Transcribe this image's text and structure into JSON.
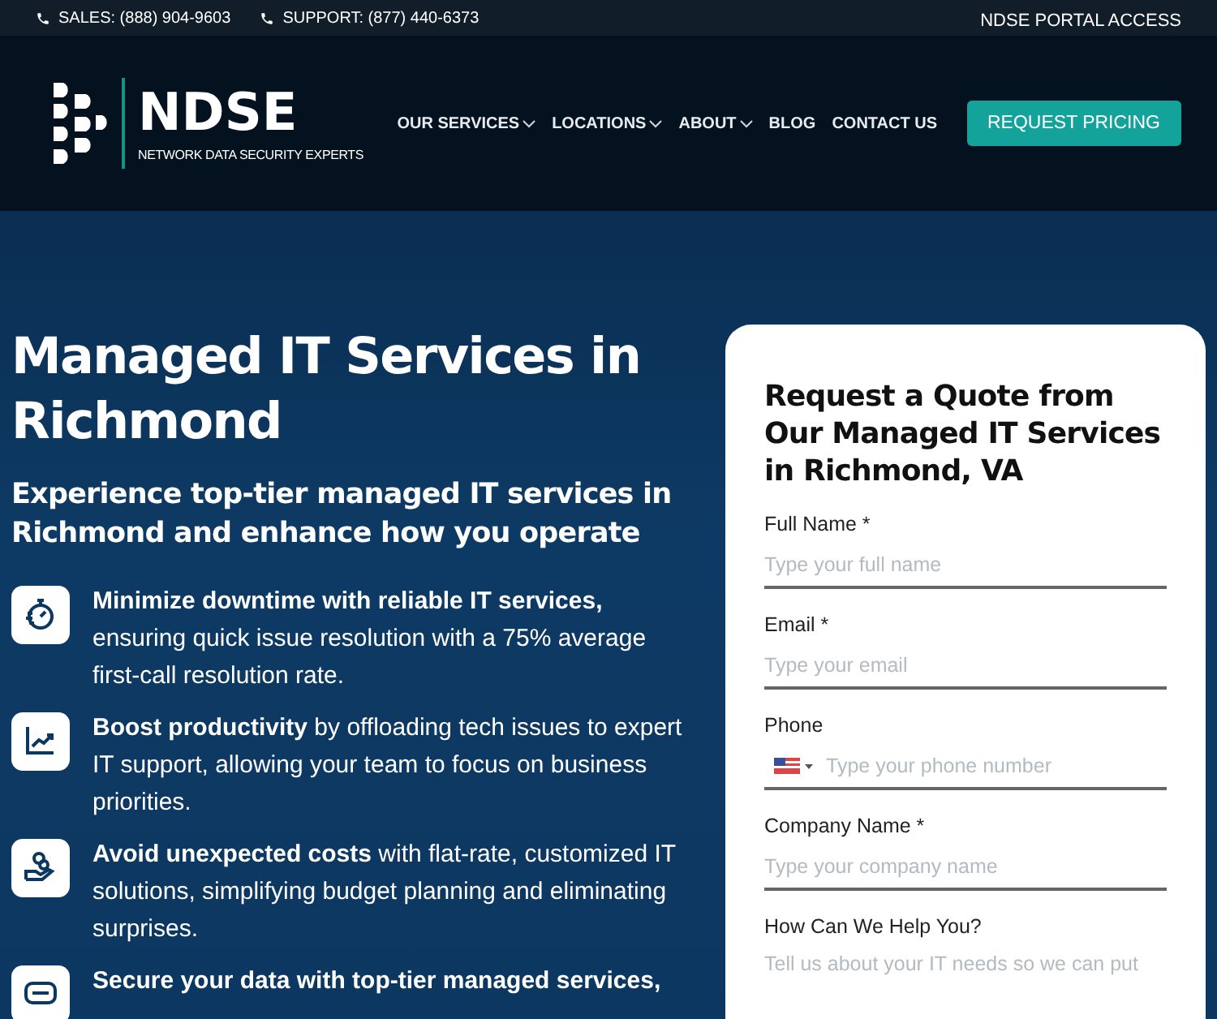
{
  "top_bar": {
    "contacts": [
      {
        "label": "SALES: (888) 904-9603"
      },
      {
        "label": "SUPPORT: (877) 440-6373"
      }
    ],
    "portal_link": "NDSE PORTAL ACCESS"
  },
  "header": {
    "logo": {
      "name": "NDSE",
      "tagline": "NETWORK DATA SECURITY EXPERTS"
    },
    "nav": [
      {
        "label": "OUR SERVICES",
        "has_dropdown": true
      },
      {
        "label": "LOCATIONS",
        "has_dropdown": true
      },
      {
        "label": "ABOUT",
        "has_dropdown": true
      },
      {
        "label": "BLOG",
        "has_dropdown": false
      },
      {
        "label": "CONTACT US",
        "has_dropdown": false
      }
    ],
    "cta": "REQUEST PRICING"
  },
  "hero": {
    "title": "Managed IT Services in Richmond",
    "subtitle": "Experience top-tier managed IT services in Richmond and enhance how you operate",
    "benefits": [
      {
        "kind": "stopwatch",
        "text": "**Minimize downtime with reliable IT services,** ensuring quick issue resolution with a 75% average first-call resolution rate."
      },
      {
        "kind": "chart",
        "text": "**Boost productivity** by offloading tech issues to expert IT support, allowing your team to focus on business priorities."
      },
      {
        "kind": "hand-coins",
        "text": "**Avoid unexpected costs** with flat-rate, customized IT solutions, simplifying budget planning and eliminating surprises."
      },
      {
        "kind": "card",
        "text": "**Secure your data with top-tier managed services,**"
      }
    ]
  },
  "form": {
    "title": "Request a Quote from Our Managed IT Services in Richmond, VA",
    "fields": [
      {
        "kind": "text",
        "label": "Full Name *",
        "placeholder": "Type your full name"
      },
      {
        "kind": "text",
        "label": "Email *",
        "placeholder": "Type your email"
      },
      {
        "kind": "phone",
        "label": "Phone",
        "placeholder": "Type your phone number"
      },
      {
        "kind": "text",
        "label": "Company Name *",
        "placeholder": "Type your company name"
      },
      {
        "kind": "textarea",
        "label": "How Can We Help You?",
        "placeholder": "Tell us about your IT needs so we can put"
      }
    ]
  }
}
